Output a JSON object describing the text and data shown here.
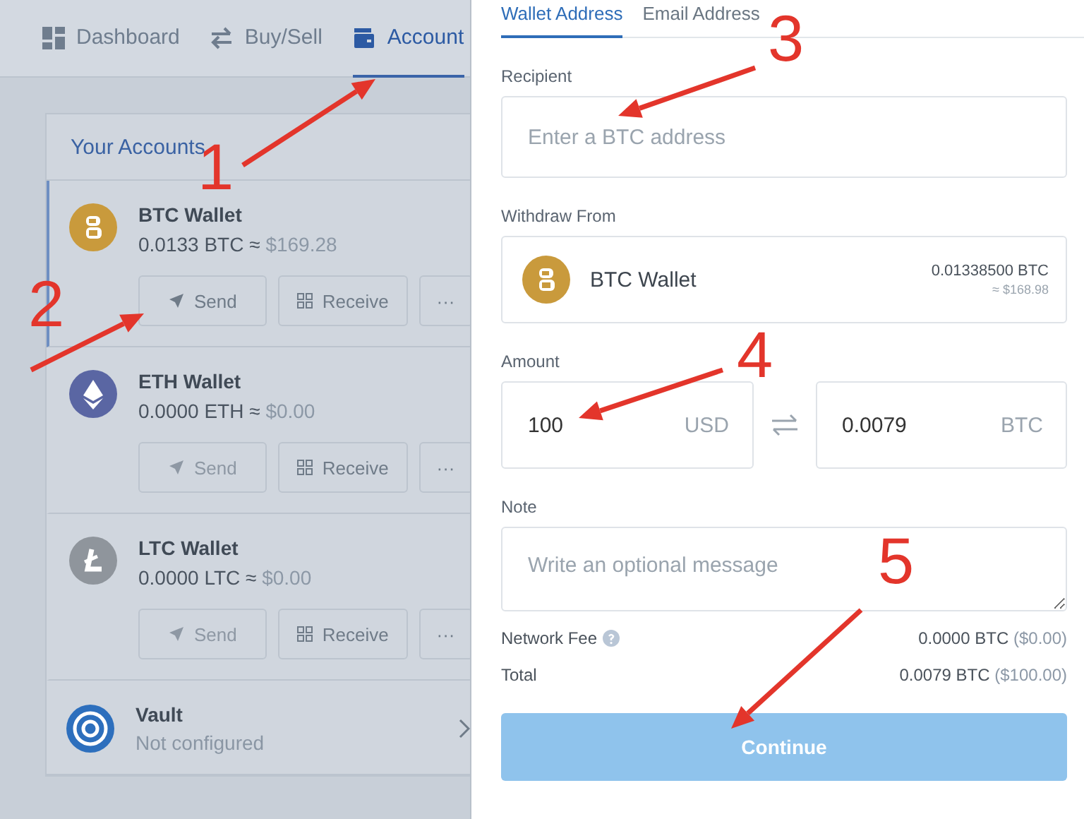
{
  "nav": {
    "items": [
      {
        "label": "Dashboard",
        "kind": "dashboard",
        "selected": false
      },
      {
        "label": "Buy/Sell",
        "kind": "trade",
        "selected": false
      },
      {
        "label": "Account",
        "kind": "accounts",
        "selected": true
      }
    ]
  },
  "accounts": {
    "title": "Your Accounts",
    "wallets": [
      {
        "kind": "btc",
        "name": "BTC Wallet",
        "crypto": "0.0133 BTC ≈",
        "fiat": "$169.28",
        "selected": true,
        "send_disabled": false,
        "send": "Send",
        "receive": "Receive",
        "more": "···"
      },
      {
        "kind": "eth",
        "name": "ETH Wallet",
        "crypto": "0.0000 ETH ≈",
        "fiat": "$0.00",
        "selected": false,
        "send_disabled": true,
        "send": "Send",
        "receive": "Receive",
        "more": "···"
      },
      {
        "kind": "ltc",
        "name": "LTC Wallet",
        "crypto": "0.0000 LTC ≈",
        "fiat": "$0.00",
        "selected": false,
        "send_disabled": true,
        "send": "Send",
        "receive": "Receive",
        "more": "···"
      }
    ],
    "vault": {
      "name": "Vault",
      "status": "Not configured"
    }
  },
  "send_form": {
    "tabs": [
      {
        "label": "Wallet Address",
        "selected": true
      },
      {
        "label": "Email Address",
        "selected": false
      }
    ],
    "recipient": {
      "label": "Recipient",
      "placeholder": "Enter a BTC address"
    },
    "withdraw_from": {
      "label": "Withdraw From",
      "wallet": "BTC Wallet",
      "crypto": "0.01338500 BTC",
      "fiat": "≈ $168.98"
    },
    "amount": {
      "label": "Amount",
      "fiat_value": "100",
      "fiat_unit": "USD",
      "crypto_value": "0.0079",
      "crypto_unit": "BTC"
    },
    "note": {
      "label": "Note",
      "placeholder": "Write an optional message"
    },
    "network_fee": {
      "label": "Network Fee",
      "amount": "0.0000 BTC",
      "fiat": "($0.00)"
    },
    "total": {
      "label": "Total",
      "amount": "0.0079 BTC",
      "fiat": "($100.00)"
    },
    "continue_button": "Continue"
  },
  "annotations": [
    {
      "label": "1"
    },
    {
      "label": "2"
    },
    {
      "label": "3"
    },
    {
      "label": "4"
    },
    {
      "label": "5"
    }
  ]
}
